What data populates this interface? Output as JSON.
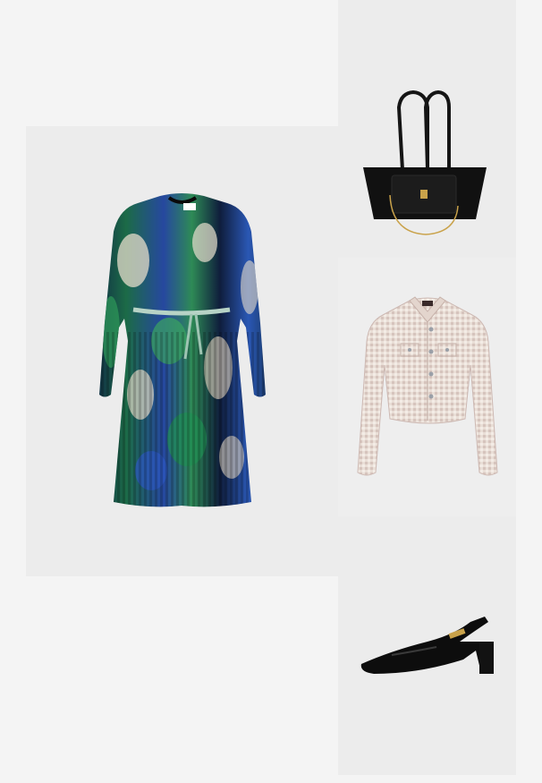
{
  "collage": {
    "background_color": "#f4f4f4",
    "items": [
      {
        "name": "dress",
        "icon": "pleated-print-dress-icon",
        "colors": [
          "#0c1b3a",
          "#1b7a4a",
          "#2a4fb0",
          "#e6dccb"
        ]
      },
      {
        "name": "handbag",
        "icon": "black-leather-tote-icon",
        "colors": [
          "#111111",
          "#c9a24a"
        ]
      },
      {
        "name": "jacket",
        "icon": "tweed-cropped-jacket-icon",
        "colors": [
          "#e8ddd5",
          "#cdb9b3"
        ]
      },
      {
        "name": "shoe",
        "icon": "black-slingback-pump-icon",
        "colors": [
          "#0d0d0d",
          "#c9a24a"
        ]
      }
    ]
  }
}
